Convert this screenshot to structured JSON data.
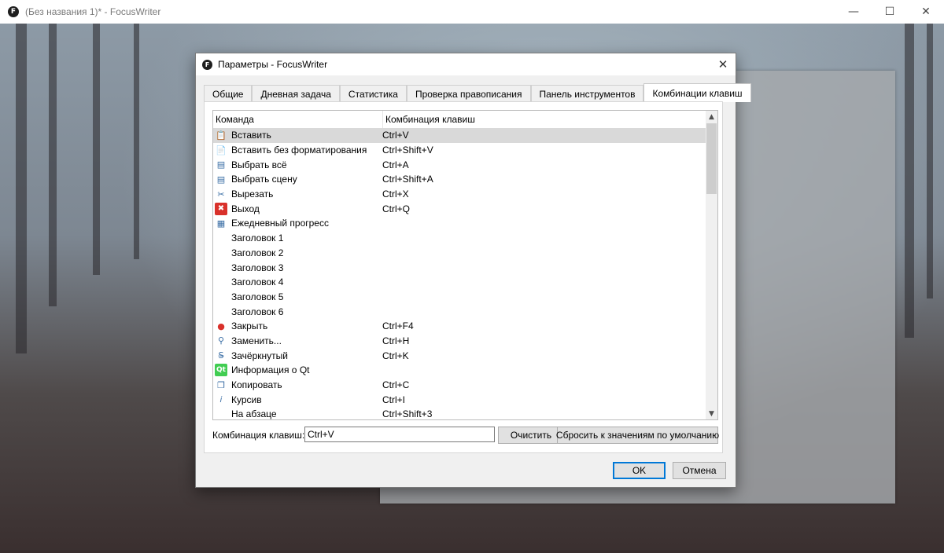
{
  "main_window": {
    "title": "(Без названия 1)* - FocusWriter",
    "icon_letter": "F",
    "minimize": "—",
    "maximize": "☐",
    "close": "✕"
  },
  "dialog": {
    "title": "Параметры - FocusWriter",
    "icon_letter": "F",
    "close": "✕",
    "tabs": [
      {
        "label": "Общие",
        "active": false
      },
      {
        "label": "Дневная задача",
        "active": false
      },
      {
        "label": "Статистика",
        "active": false
      },
      {
        "label": "Проверка правописания",
        "active": false
      },
      {
        "label": "Панель инструментов",
        "active": false
      },
      {
        "label": "Комбинации клавиш",
        "active": true
      }
    ],
    "list": {
      "columns": {
        "command": "Команда",
        "shortcut": "Комбинация клавиш"
      },
      "rows": [
        {
          "command": "Вставить",
          "shortcut": "Ctrl+V",
          "icon": "paste-icon",
          "glyph": "📋",
          "selected": true
        },
        {
          "command": "Вставить без форматирования",
          "shortcut": "Ctrl+Shift+V",
          "icon": "paste-plain-icon",
          "glyph": "📄"
        },
        {
          "command": "Выбрать всё",
          "shortcut": "Ctrl+A",
          "icon": "select-all-icon",
          "glyph": "▤"
        },
        {
          "command": "Выбрать сцену",
          "shortcut": "Ctrl+Shift+A",
          "icon": "select-scene-icon",
          "glyph": "▤"
        },
        {
          "command": "Вырезать",
          "shortcut": "Ctrl+X",
          "icon": "scissors-icon",
          "glyph": "✂"
        },
        {
          "command": "Выход",
          "shortcut": "Ctrl+Q",
          "icon": "exit-icon",
          "glyph": "✖"
        },
        {
          "command": "Ежедневный прогресс",
          "shortcut": "",
          "icon": "calendar-icon",
          "glyph": "▦"
        },
        {
          "command": "Заголовок 1",
          "shortcut": "",
          "icon": "",
          "glyph": ""
        },
        {
          "command": "Заголовок 2",
          "shortcut": "",
          "icon": "",
          "glyph": ""
        },
        {
          "command": "Заголовок 3",
          "shortcut": "",
          "icon": "",
          "glyph": ""
        },
        {
          "command": "Заголовок 4",
          "shortcut": "",
          "icon": "",
          "glyph": ""
        },
        {
          "command": "Заголовок 5",
          "shortcut": "",
          "icon": "",
          "glyph": ""
        },
        {
          "command": "Заголовок 6",
          "shortcut": "",
          "icon": "",
          "glyph": ""
        },
        {
          "command": "Закрыть",
          "shortcut": "Ctrl+F4",
          "icon": "close-document-icon",
          "glyph": "●"
        },
        {
          "command": "Заменить...",
          "shortcut": "Ctrl+H",
          "icon": "binoculars-icon",
          "glyph": "⚲"
        },
        {
          "command": "Зачёркнутый",
          "shortcut": "Ctrl+K",
          "icon": "strikethrough-icon",
          "glyph": "S̶"
        },
        {
          "command": "Информация о Qt",
          "shortcut": "",
          "icon": "qt-logo-icon",
          "glyph": "Qt"
        },
        {
          "command": "Копировать",
          "shortcut": "Ctrl+C",
          "icon": "copy-icon",
          "glyph": "❐"
        },
        {
          "command": "Курсив",
          "shortcut": "Ctrl+I",
          "icon": "italic-icon",
          "glyph": "𝑖"
        },
        {
          "command": "На абзаце",
          "shortcut": "Ctrl+Shift+3",
          "icon": "",
          "glyph": ""
        }
      ]
    },
    "key_label": "Комбинация клавиш:",
    "key_value": "Ctrl+V",
    "clear_label": "Очистить",
    "reset_label": "Сбросить к значениям по умолчанию",
    "ok_label": "OK",
    "cancel_label": "Отмена"
  },
  "colors": {
    "selection": "#d9d9d9",
    "default_button_border": "#0078d7",
    "qt_green": "#41cd52",
    "exit_red": "#d9312b"
  }
}
